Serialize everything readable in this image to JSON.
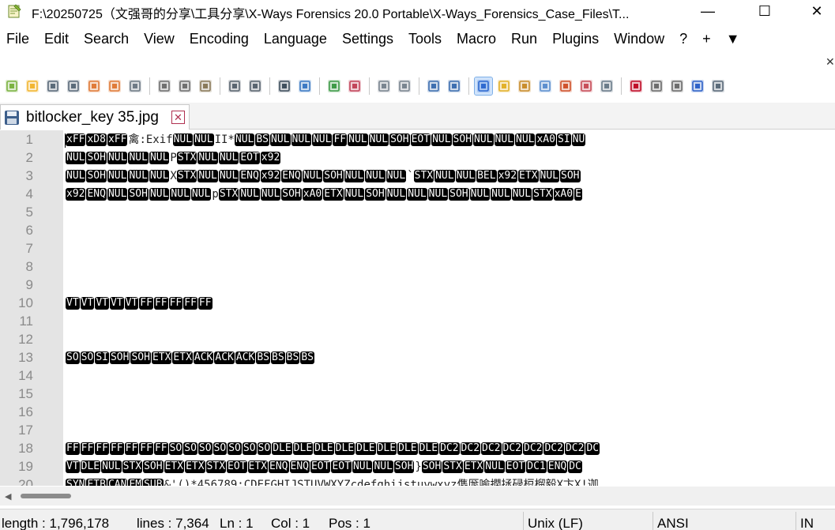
{
  "window": {
    "title": "F:\\20250725（文强哥的分享\\工具分享\\X-Ways Forensics 20.0 Portable\\X-Ways_Forensics_Case_Files\\T...",
    "minimize_glyph": "—",
    "maximize_glyph": "☐",
    "close_glyph": "✕"
  },
  "menu": {
    "items": [
      "File",
      "Edit",
      "Search",
      "View",
      "Encoding",
      "Language",
      "Settings",
      "Tools",
      "Macro",
      "Run",
      "Plugins",
      "Window",
      "?",
      "+",
      "▼"
    ],
    "overflow_glyph": "✕"
  },
  "toolbar": {
    "icons": [
      {
        "name": "new-file-icon",
        "color": "#7cb342"
      },
      {
        "name": "open-file-icon",
        "color": "#f2b632"
      },
      {
        "name": "save-icon",
        "color": "#5b6b7a"
      },
      {
        "name": "save-all-icon",
        "color": "#5b6b7a"
      },
      {
        "name": "close-file-icon",
        "color": "#e07b39"
      },
      {
        "name": "close-all-icon",
        "color": "#e07b39"
      },
      {
        "name": "print-icon",
        "color": "#6f7b86"
      },
      {
        "name": "sep"
      },
      {
        "name": "cut-icon",
        "color": "#707070"
      },
      {
        "name": "copy-icon",
        "color": "#707070"
      },
      {
        "name": "paste-icon",
        "color": "#8a7a5a"
      },
      {
        "name": "sep"
      },
      {
        "name": "undo-icon",
        "color": "#5a6570"
      },
      {
        "name": "redo-icon",
        "color": "#5a6570"
      },
      {
        "name": "sep"
      },
      {
        "name": "find-icon",
        "color": "#40505e"
      },
      {
        "name": "replace-icon",
        "color": "#3d7ac4"
      },
      {
        "name": "sep"
      },
      {
        "name": "zoom-in-icon",
        "color": "#3f9a48"
      },
      {
        "name": "zoom-out-icon",
        "color": "#c2455a"
      },
      {
        "name": "sep"
      },
      {
        "name": "sync-vertical-icon",
        "color": "#7a8590"
      },
      {
        "name": "sync-horizontal-icon",
        "color": "#7a8590"
      },
      {
        "name": "sep"
      },
      {
        "name": "word-wrap-icon",
        "color": "#3e6fb0"
      },
      {
        "name": "show-all-characters-icon",
        "color": "#3e6fb0"
      },
      {
        "name": "sep"
      },
      {
        "name": "indent-guide-icon",
        "color": "#2f6ad0"
      },
      {
        "name": "user-defined-language-icon",
        "color": "#e2b12a"
      },
      {
        "name": "document-map-icon",
        "color": "#c98d2c"
      },
      {
        "name": "document-list-icon",
        "color": "#5d8fcf"
      },
      {
        "name": "function-list-icon",
        "color": "#d0522d"
      },
      {
        "name": "folder-as-workspace-icon",
        "color": "#c84f5a"
      },
      {
        "name": "monitoring-icon",
        "color": "#6b7c8a"
      },
      {
        "name": "sep"
      },
      {
        "name": "record-macro-icon",
        "color": "#c0102a"
      },
      {
        "name": "stop-recording-icon",
        "color": "#6d6d6d"
      },
      {
        "name": "playback-macro-icon",
        "color": "#6d6d6d"
      },
      {
        "name": "run-macro-multiple-icon",
        "color": "#2f62c8"
      },
      {
        "name": "save-macro-icon",
        "color": "#5b6b7a"
      }
    ]
  },
  "tab": {
    "label": "bitlocker_key 35.jpg",
    "close_glyph": "✕"
  },
  "editor": {
    "lines": [
      {
        "num": "1",
        "tokens": [
          [
            "c",
            "xFF"
          ],
          [
            "c",
            "xD8"
          ],
          [
            "c",
            "xFF"
          ],
          [
            "t",
            "禽:Exif"
          ],
          [
            "c",
            "NUL"
          ],
          [
            "c",
            "NUL"
          ],
          [
            "t",
            "II*"
          ],
          [
            "c",
            "NUL"
          ],
          [
            "c",
            "BS"
          ],
          [
            "c",
            "NUL"
          ],
          [
            "c",
            "NUL"
          ],
          [
            "c",
            "NUL"
          ],
          [
            "c",
            "FF"
          ],
          [
            "c",
            "NUL"
          ],
          [
            "c",
            "NUL"
          ],
          [
            "c",
            "SOH"
          ],
          [
            "c",
            "EOT"
          ],
          [
            "c",
            "NUL"
          ],
          [
            "c",
            "SOH"
          ],
          [
            "c",
            "NUL"
          ],
          [
            "c",
            "NUL"
          ],
          [
            "c",
            "NUL"
          ],
          [
            "c",
            "xA0"
          ],
          [
            "c",
            "SI"
          ],
          [
            "c",
            "NU"
          ]
        ]
      },
      {
        "num": "2",
        "tokens": [
          [
            "c",
            "NUL"
          ],
          [
            "c",
            "SOH"
          ],
          [
            "c",
            "NUL"
          ],
          [
            "c",
            "NUL"
          ],
          [
            "c",
            "NUL"
          ],
          [
            "t",
            "P"
          ],
          [
            "c",
            "STX"
          ],
          [
            "c",
            "NUL"
          ],
          [
            "c",
            "NUL"
          ],
          [
            "c",
            "EOT"
          ],
          [
            "c",
            "x92"
          ]
        ]
      },
      {
        "num": "3",
        "tokens": [
          [
            "c",
            "NUL"
          ],
          [
            "c",
            "SOH"
          ],
          [
            "c",
            "NUL"
          ],
          [
            "c",
            "NUL"
          ],
          [
            "c",
            "NUL"
          ],
          [
            "t",
            "X"
          ],
          [
            "c",
            "STX"
          ],
          [
            "c",
            "NUL"
          ],
          [
            "c",
            "NUL"
          ],
          [
            "c",
            "ENQ"
          ],
          [
            "c",
            "x92"
          ],
          [
            "c",
            "ENQ"
          ],
          [
            "c",
            "NUL"
          ],
          [
            "c",
            "SOH"
          ],
          [
            "c",
            "NUL"
          ],
          [
            "c",
            "NUL"
          ],
          [
            "c",
            "NUL"
          ],
          [
            "t",
            "`"
          ],
          [
            "c",
            "STX"
          ],
          [
            "c",
            "NUL"
          ],
          [
            "c",
            "NUL"
          ],
          [
            "c",
            "BEL"
          ],
          [
            "c",
            "x92"
          ],
          [
            "c",
            "ETX"
          ],
          [
            "c",
            "NUL"
          ],
          [
            "c",
            "SOH"
          ]
        ]
      },
      {
        "num": "4",
        "tokens": [
          [
            "c",
            "x92"
          ],
          [
            "c",
            "ENQ"
          ],
          [
            "c",
            "NUL"
          ],
          [
            "c",
            "SOH"
          ],
          [
            "c",
            "NUL"
          ],
          [
            "c",
            "NUL"
          ],
          [
            "c",
            "NUL"
          ],
          [
            "t",
            "p"
          ],
          [
            "c",
            "STX"
          ],
          [
            "c",
            "NUL"
          ],
          [
            "c",
            "NUL"
          ],
          [
            "c",
            "SOH"
          ],
          [
            "c",
            "xA0"
          ],
          [
            "c",
            "ETX"
          ],
          [
            "c",
            "NUL"
          ],
          [
            "c",
            "SOH"
          ],
          [
            "c",
            "NUL"
          ],
          [
            "c",
            "NUL"
          ],
          [
            "c",
            "NUL"
          ],
          [
            "c",
            "SOH"
          ],
          [
            "c",
            "NUL"
          ],
          [
            "c",
            "NUL"
          ],
          [
            "c",
            "NUL"
          ],
          [
            "c",
            "STX"
          ],
          [
            "c",
            "xA0"
          ],
          [
            "c",
            "E"
          ]
        ]
      },
      {
        "num": "5",
        "tokens": []
      },
      {
        "num": "6",
        "tokens": []
      },
      {
        "num": "7",
        "tokens": []
      },
      {
        "num": "8",
        "tokens": []
      },
      {
        "num": "9",
        "tokens": []
      },
      {
        "num": "10",
        "tokens": [
          [
            "c",
            "VT"
          ],
          [
            "c",
            "VT"
          ],
          [
            "c",
            "VT"
          ],
          [
            "c",
            "VT"
          ],
          [
            "c",
            "VT"
          ],
          [
            "c",
            "FF"
          ],
          [
            "c",
            "FF"
          ],
          [
            "c",
            "FF"
          ],
          [
            "c",
            "FF"
          ],
          [
            "c",
            "FF"
          ]
        ]
      },
      {
        "num": "11",
        "tokens": []
      },
      {
        "num": "12",
        "tokens": []
      },
      {
        "num": "13",
        "tokens": [
          [
            "c",
            "SO"
          ],
          [
            "c",
            "SO"
          ],
          [
            "c",
            "SI"
          ],
          [
            "c",
            "SOH"
          ],
          [
            "c",
            "SOH"
          ],
          [
            "c",
            "ETX"
          ],
          [
            "c",
            "ETX"
          ],
          [
            "c",
            "ACK"
          ],
          [
            "c",
            "ACK"
          ],
          [
            "c",
            "ACK"
          ],
          [
            "c",
            "BS"
          ],
          [
            "c",
            "BS"
          ],
          [
            "c",
            "BS"
          ],
          [
            "c",
            "BS"
          ]
        ]
      },
      {
        "num": "14",
        "tokens": []
      },
      {
        "num": "15",
        "tokens": []
      },
      {
        "num": "16",
        "tokens": []
      },
      {
        "num": "17",
        "tokens": []
      },
      {
        "num": "18",
        "tokens": [
          [
            "c",
            "FF"
          ],
          [
            "c",
            "FF"
          ],
          [
            "c",
            "FF"
          ],
          [
            "c",
            "FF"
          ],
          [
            "c",
            "FF"
          ],
          [
            "c",
            "FF"
          ],
          [
            "c",
            "FF"
          ],
          [
            "c",
            "SO"
          ],
          [
            "c",
            "SO"
          ],
          [
            "c",
            "SO"
          ],
          [
            "c",
            "SO"
          ],
          [
            "c",
            "SO"
          ],
          [
            "c",
            "SO"
          ],
          [
            "c",
            "SO"
          ],
          [
            "c",
            "DLE"
          ],
          [
            "c",
            "DLE"
          ],
          [
            "c",
            "DLE"
          ],
          [
            "c",
            "DLE"
          ],
          [
            "c",
            "DLE"
          ],
          [
            "c",
            "DLE"
          ],
          [
            "c",
            "DLE"
          ],
          [
            "c",
            "DLE"
          ],
          [
            "c",
            "DC2"
          ],
          [
            "c",
            "DC2"
          ],
          [
            "c",
            "DC2"
          ],
          [
            "c",
            "DC2"
          ],
          [
            "c",
            "DC2"
          ],
          [
            "c",
            "DC2"
          ],
          [
            "c",
            "DC2"
          ],
          [
            "c",
            "DC"
          ]
        ]
      },
      {
        "num": "19",
        "tokens": [
          [
            "c",
            "VT"
          ],
          [
            "c",
            "DLE"
          ],
          [
            "c",
            "NUL"
          ],
          [
            "c",
            "STX"
          ],
          [
            "c",
            "SOH"
          ],
          [
            "c",
            "ETX"
          ],
          [
            "c",
            "ETX"
          ],
          [
            "c",
            "STX"
          ],
          [
            "c",
            "EOT"
          ],
          [
            "c",
            "ETX"
          ],
          [
            "c",
            "ENQ"
          ],
          [
            "c",
            "ENQ"
          ],
          [
            "c",
            "EOT"
          ],
          [
            "c",
            "EOT"
          ],
          [
            "c",
            "NUL"
          ],
          [
            "c",
            "NUL"
          ],
          [
            "c",
            "SOH"
          ],
          [
            "t",
            "}"
          ],
          [
            "c",
            "SOH"
          ],
          [
            "c",
            "STX"
          ],
          [
            "c",
            "ETX"
          ],
          [
            "c",
            "NUL"
          ],
          [
            "c",
            "EOT"
          ],
          [
            "c",
            "DC1"
          ],
          [
            "c",
            "ENQ"
          ],
          [
            "c",
            "DC"
          ]
        ]
      },
      {
        "num": "20",
        "tokens": [
          [
            "c",
            "SYN"
          ],
          [
            "c",
            "ETB"
          ],
          [
            "c",
            "CAN"
          ],
          [
            "c",
            "EM"
          ],
          [
            "c",
            "SUB"
          ],
          [
            "t",
            "&'()*456789:CDEFGHIJSTUVWXYZcdefghijstuvwxyz儁厖喻撋拯碌梪榴毅X卞X!迦"
          ]
        ]
      }
    ]
  },
  "statusbar": {
    "length": "length : 1,796,178",
    "lines": "lines : 7,364",
    "ln": "Ln : 1",
    "col": "Col : 1",
    "pos": "Pos : 1",
    "eol": "Unix (LF)",
    "encoding": "ANSI",
    "mode": "IN"
  }
}
